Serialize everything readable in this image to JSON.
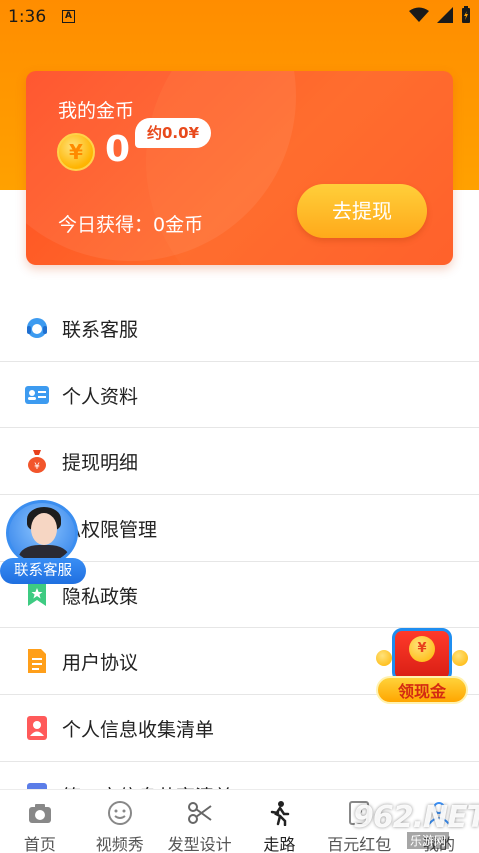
{
  "status_bar": {
    "time": "1:36",
    "notification_icon": "a-notification-icon"
  },
  "coin_card": {
    "title": "我的金币",
    "coin_amount": "0",
    "approx_value": "约0.0¥",
    "today_earned": "今日获得：0金币",
    "withdraw_button": "去提现",
    "coin_symbol": "¥"
  },
  "menu": {
    "items": [
      {
        "label": "联系客服",
        "icon": "headset-icon"
      },
      {
        "label": "个人资料",
        "icon": "id-card-icon"
      },
      {
        "label": "提现明细",
        "icon": "money-bag-icon"
      },
      {
        "label": "私权限管理",
        "icon": "shield-icon"
      },
      {
        "label": "隐私政策",
        "icon": "bookmark-icon"
      },
      {
        "label": "用户协议",
        "icon": "document-icon"
      },
      {
        "label": "个人信息收集清单",
        "icon": "person-card-icon"
      },
      {
        "label": "第三方信息共享清单",
        "icon": "list-icon"
      }
    ]
  },
  "float_service": {
    "label": "联系客服"
  },
  "float_cash": {
    "label": "领现金",
    "coin_symbol": "¥"
  },
  "bottom_nav": {
    "items": [
      {
        "label": "首页",
        "icon": "camera-icon"
      },
      {
        "label": "视频秀",
        "icon": "smiley-icon"
      },
      {
        "label": "发型设计",
        "icon": "scissors-icon"
      },
      {
        "label": "走路",
        "icon": "walking-icon"
      },
      {
        "label": "百元红包",
        "icon": "red-packet-icon"
      },
      {
        "label": "我的",
        "icon": "person-icon"
      }
    ]
  },
  "watermark": {
    "text": "962.NET",
    "sub": "乐游网"
  },
  "colors": {
    "accent": "#ff8d00",
    "card": "#ff5a26",
    "button": "#ffb21f"
  }
}
